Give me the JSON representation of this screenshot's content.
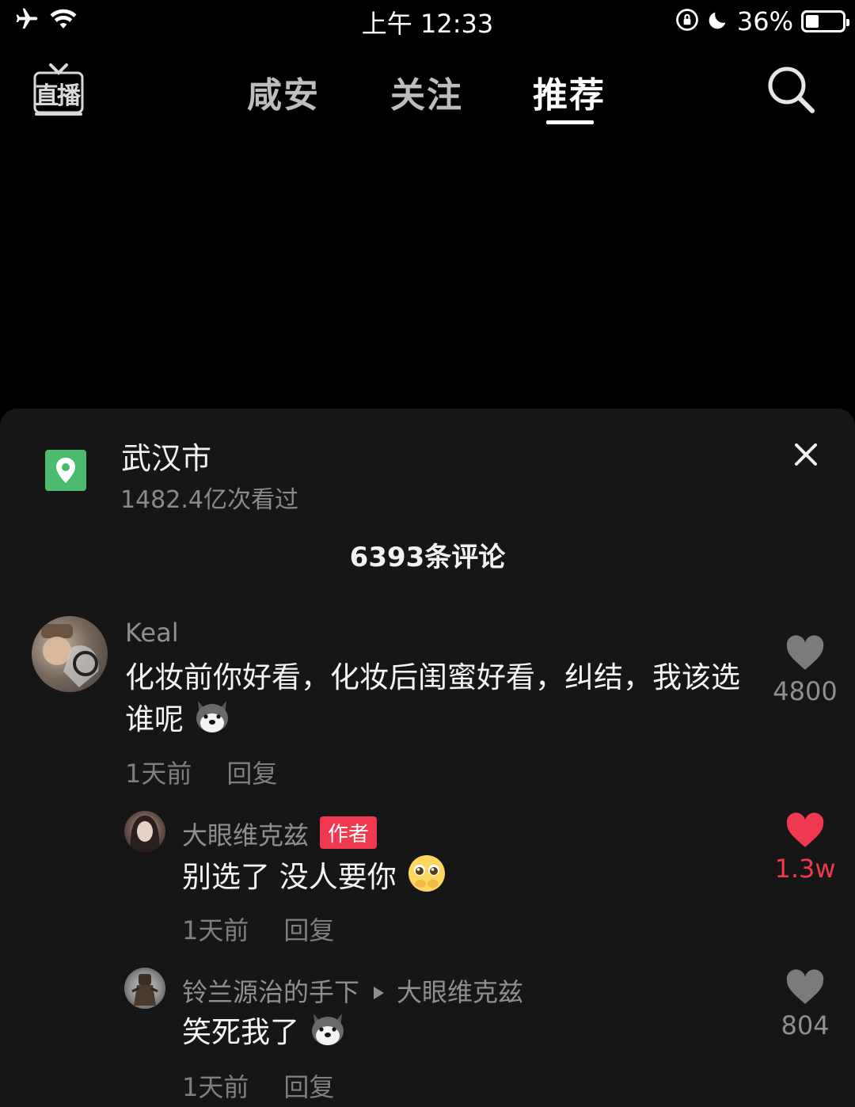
{
  "status_bar": {
    "time": "上午 12:33",
    "battery": "36%",
    "battery_level": 0.36,
    "icons": [
      "airplane-icon",
      "wifi-icon",
      "orientation-lock-icon",
      "moon-icon",
      "battery-icon"
    ]
  },
  "top_nav": {
    "live_label": "直播",
    "tabs": [
      {
        "label": "咸安",
        "active": false
      },
      {
        "label": "关注",
        "active": false
      },
      {
        "label": "推荐",
        "active": true
      }
    ],
    "search_icon": "search-icon"
  },
  "location": {
    "title": "武汉市",
    "views": "1482.4亿次看过"
  },
  "comments_header": "6393条评论",
  "comments": [
    {
      "user": "Keal",
      "text": "化妆前你好看，化妆后闺蜜好看，纠结，我该选谁呢",
      "emoji": "husky-emoji",
      "time": "1天前",
      "reply": "回复",
      "likes": "4800",
      "liked": false
    },
    {
      "user": "大眼维克兹",
      "badge": "作者",
      "text": "别选了 没人要你",
      "emoji": "pleading-emoji",
      "time": "1天前",
      "reply": "回复",
      "likes": "1.3w",
      "liked": true
    },
    {
      "user": "铃兰源治的手下",
      "reply_to": "大眼维克兹",
      "text": "笑死我了",
      "emoji": "husky-emoji",
      "time": "1天前",
      "reply": "回复",
      "likes": "804",
      "liked": false
    }
  ],
  "colors": {
    "background": "#000000",
    "sheet": "#161616",
    "accent_red": "#f0384e",
    "location_green": "#4cbb6d"
  }
}
